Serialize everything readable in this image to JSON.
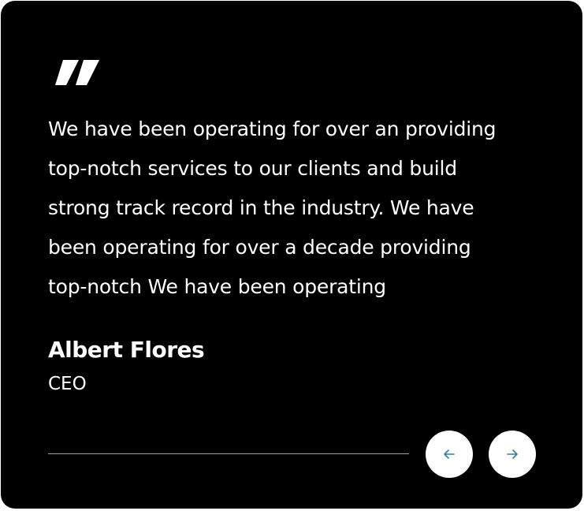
{
  "testimonial": {
    "quote_icon": "double-quote-icon",
    "quote_lines": [
      "We have been operating for over an providing",
      "top-notch services to our clients and build",
      "strong track record in the industry. We have",
      "been operating for over a decade providing",
      "top-notch  We have been operating"
    ],
    "author_name": "Albert Flores",
    "author_role": "CEO"
  },
  "navigation": {
    "prev_icon": "arrow-left-icon",
    "next_icon": "arrow-right-icon"
  },
  "colors": {
    "card_background": "#000000",
    "text": "#ffffff",
    "divider": "#9aa3a8",
    "button_background": "#ffffff",
    "arrow": "#2f7fa8"
  }
}
